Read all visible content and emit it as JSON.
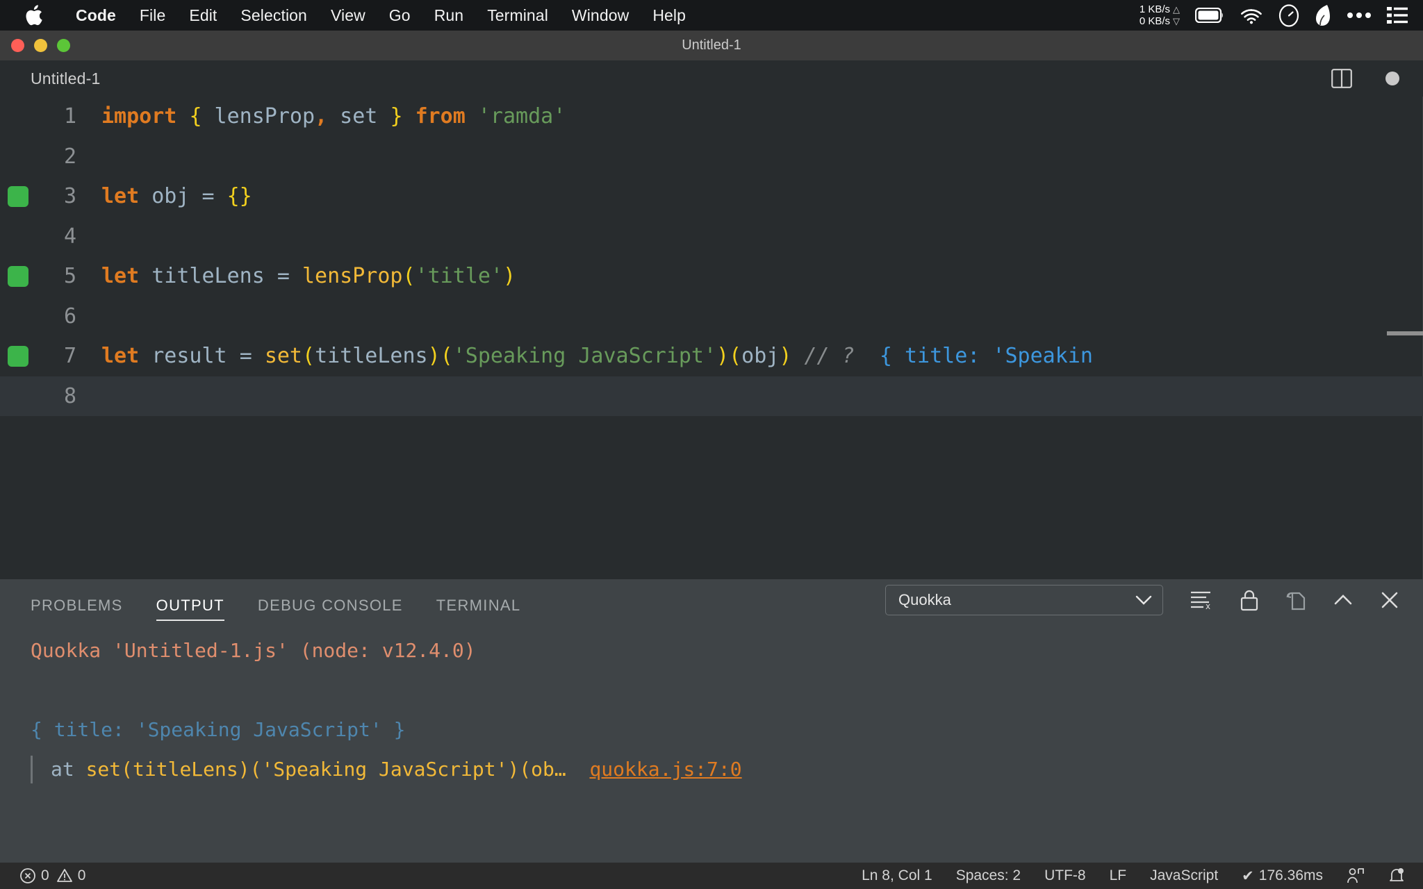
{
  "macmenu": {
    "apple_icon": "apple-logo-icon",
    "items": [
      {
        "label": "Code",
        "bold": true
      },
      {
        "label": "File",
        "bold": false
      },
      {
        "label": "Edit",
        "bold": false
      },
      {
        "label": "Selection",
        "bold": false
      },
      {
        "label": "View",
        "bold": false
      },
      {
        "label": "Go",
        "bold": false
      },
      {
        "label": "Run",
        "bold": false
      },
      {
        "label": "Terminal",
        "bold": false
      },
      {
        "label": "Window",
        "bold": false
      },
      {
        "label": "Help",
        "bold": false
      }
    ],
    "network": {
      "up": "1 KB/s",
      "down": "0 KB/s",
      "up_arrow": "△",
      "down_arrow": "▽"
    },
    "status_icons": [
      "battery-icon",
      "wifi-icon",
      "speedometer-icon",
      "leaf-icon",
      "ellipsis-icon",
      "control-center-icon"
    ]
  },
  "window": {
    "title": "Untitled-1",
    "traffic_lights": [
      "close-button",
      "minimize-button",
      "zoom-button"
    ],
    "colors": {
      "close": "#ff5f57",
      "minimize": "#f0c23c",
      "zoom": "#5cc638"
    }
  },
  "editor": {
    "tab_label": "Untitled-1",
    "split_icon": "split-editor-icon",
    "dirty_icon": "unsaved-dot-icon",
    "lines": [
      {
        "n": "1",
        "marker": false,
        "current": false,
        "tokens": [
          {
            "t": "import",
            "c": "k"
          },
          {
            "t": " ",
            "c": "op"
          },
          {
            "t": "{",
            "c": "br"
          },
          {
            "t": " lensProp",
            "c": "id"
          },
          {
            "t": ",",
            "c": "k"
          },
          {
            "t": " set ",
            "c": "id"
          },
          {
            "t": "}",
            "c": "br"
          },
          {
            "t": " ",
            "c": "op"
          },
          {
            "t": "from",
            "c": "k"
          },
          {
            "t": " ",
            "c": "op"
          },
          {
            "t": "'ramda'",
            "c": "str"
          }
        ]
      },
      {
        "n": "2",
        "marker": false,
        "current": false,
        "tokens": []
      },
      {
        "n": "3",
        "marker": true,
        "current": false,
        "tokens": [
          {
            "t": "let",
            "c": "k"
          },
          {
            "t": " obj ",
            "c": "id"
          },
          {
            "t": "=",
            "c": "op"
          },
          {
            "t": " ",
            "c": "op"
          },
          {
            "t": "{}",
            "c": "br"
          }
        ]
      },
      {
        "n": "4",
        "marker": false,
        "current": false,
        "tokens": []
      },
      {
        "n": "5",
        "marker": true,
        "current": false,
        "tokens": [
          {
            "t": "let",
            "c": "k"
          },
          {
            "t": " titleLens ",
            "c": "id"
          },
          {
            "t": "=",
            "c": "op"
          },
          {
            "t": " ",
            "c": "op"
          },
          {
            "t": "lensProp",
            "c": "fn"
          },
          {
            "t": "(",
            "c": "br"
          },
          {
            "t": "'title'",
            "c": "str"
          },
          {
            "t": ")",
            "c": "br"
          }
        ]
      },
      {
        "n": "6",
        "marker": false,
        "current": false,
        "tokens": []
      },
      {
        "n": "7",
        "marker": true,
        "current": false,
        "tokens": [
          {
            "t": "let",
            "c": "k"
          },
          {
            "t": " result ",
            "c": "id"
          },
          {
            "t": "=",
            "c": "op"
          },
          {
            "t": " ",
            "c": "op"
          },
          {
            "t": "set",
            "c": "fn"
          },
          {
            "t": "(",
            "c": "br"
          },
          {
            "t": "titleLens",
            "c": "id"
          },
          {
            "t": ")",
            "c": "br"
          },
          {
            "t": "(",
            "c": "br"
          },
          {
            "t": "'Speaking JavaScript'",
            "c": "str"
          },
          {
            "t": ")",
            "c": "br"
          },
          {
            "t": "(",
            "c": "br"
          },
          {
            "t": "obj",
            "c": "id"
          },
          {
            "t": ")",
            "c": "br"
          },
          {
            "t": " ",
            "c": "op"
          },
          {
            "t": "// ?",
            "c": "cm"
          },
          {
            "t": "  { title: 'Speakin",
            "c": "qv"
          }
        ]
      },
      {
        "n": "8",
        "marker": false,
        "current": true,
        "tokens": []
      }
    ]
  },
  "panel": {
    "tabs": [
      {
        "label": "PROBLEMS",
        "active": false
      },
      {
        "label": "OUTPUT",
        "active": true
      },
      {
        "label": "DEBUG CONSOLE",
        "active": false
      },
      {
        "label": "TERMINAL",
        "active": false
      }
    ],
    "channel": "Quokka",
    "tool_icons": [
      "clear-output-icon",
      "lock-icon",
      "open-in-editor-icon",
      "maximize-panel-icon",
      "close-panel-icon"
    ],
    "output": [
      {
        "kind": "head",
        "text": "Quokka 'Untitled-1.js' (node: v12.4.0)"
      },
      {
        "kind": "blank",
        "text": ""
      },
      {
        "kind": "object",
        "text": "{ title: 'Speaking JavaScript' }"
      },
      {
        "kind": "trace",
        "at": "at ",
        "call": "set(titleLens)('Speaking JavaScript')(ob…",
        "link": "quokka.js:7:0"
      }
    ]
  },
  "statusbar": {
    "errors": "0",
    "warnings": "0",
    "cursor": "Ln 8, Col 1",
    "spaces": "Spaces: 2",
    "encoding": "UTF-8",
    "eol": "LF",
    "language": "JavaScript",
    "quokka_time": "176.36ms",
    "quokka_check": "✔",
    "right_icons": [
      "live-share-icon",
      "notifications-bell-icon"
    ]
  }
}
